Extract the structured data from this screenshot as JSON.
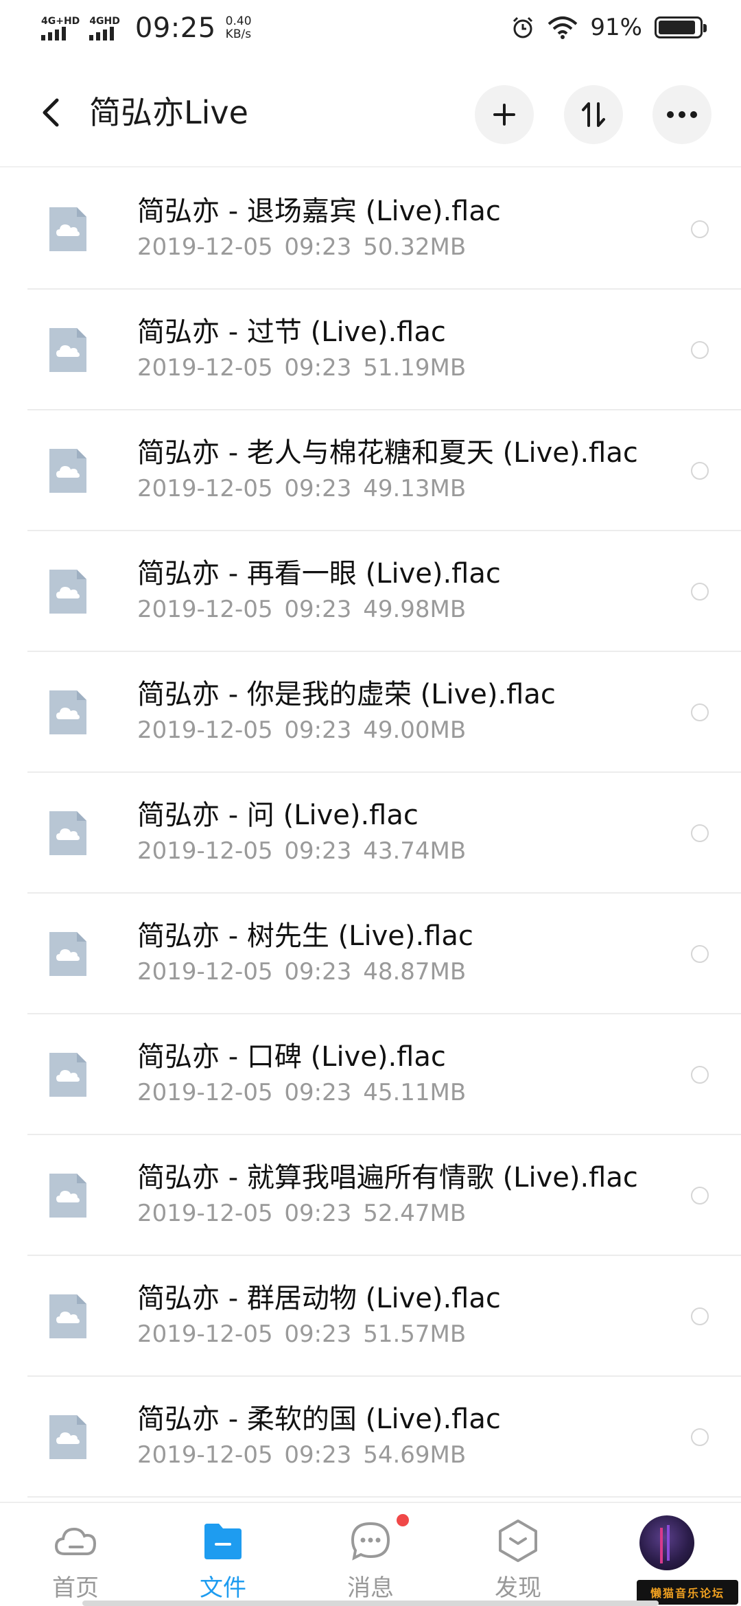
{
  "status_bar": {
    "signal1_label": "4G+HD",
    "signal2_label": "4GHD",
    "time": "09:25",
    "speed_value": "0.40",
    "speed_unit": "KB/s",
    "battery_text": "91%",
    "battery_level": 0.91
  },
  "header": {
    "title": "简弘亦Live",
    "back_icon": "chevron-left-icon",
    "add_icon": "plus-icon",
    "sort_icon": "sort-arrows-icon",
    "more_icon": "more-dots-icon"
  },
  "files": [
    {
      "name": "简弘亦 - 退场嘉宾 (Live).flac",
      "date": "2019-12-05",
      "time": "09:23",
      "size": "50.32MB"
    },
    {
      "name": "简弘亦 - 过节 (Live).flac",
      "date": "2019-12-05",
      "time": "09:23",
      "size": "51.19MB"
    },
    {
      "name": "简弘亦 - 老人与棉花糖和夏天 (Live).flac",
      "date": "2019-12-05",
      "time": "09:23",
      "size": "49.13MB"
    },
    {
      "name": "简弘亦 - 再看一眼 (Live).flac",
      "date": "2019-12-05",
      "time": "09:23",
      "size": "49.98MB"
    },
    {
      "name": "简弘亦 - 你是我的虚荣 (Live).flac",
      "date": "2019-12-05",
      "time": "09:23",
      "size": "49.00MB"
    },
    {
      "name": "简弘亦 - 问 (Live).flac",
      "date": "2019-12-05",
      "time": "09:23",
      "size": "43.74MB"
    },
    {
      "name": "简弘亦 - 树先生 (Live).flac",
      "date": "2019-12-05",
      "time": "09:23",
      "size": "48.87MB"
    },
    {
      "name": "简弘亦 - 口碑 (Live).flac",
      "date": "2019-12-05",
      "time": "09:23",
      "size": "45.11MB"
    },
    {
      "name": "简弘亦 - 就算我唱遍所有情歌 (Live).flac",
      "date": "2019-12-05",
      "time": "09:23",
      "size": "52.47MB"
    },
    {
      "name": "简弘亦 - 群居动物 (Live).flac",
      "date": "2019-12-05",
      "time": "09:23",
      "size": "51.57MB"
    },
    {
      "name": "简弘亦 - 柔软的国 (Live).flac",
      "date": "2019-12-05",
      "time": "09:23",
      "size": "54.69MB"
    }
  ],
  "bottom_nav": {
    "items": [
      {
        "label": "首页",
        "icon": "cloud-icon",
        "active": false
      },
      {
        "label": "文件",
        "icon": "folder-icon",
        "active": true
      },
      {
        "label": "消息",
        "icon": "message-icon",
        "active": false
      },
      {
        "label": "发现",
        "icon": "discover-icon",
        "active": false
      }
    ],
    "messages_badge": true
  },
  "watermark": "懒猫音乐论坛",
  "colors": {
    "accent": "#1e9cf0",
    "file_icon": "#b8c6d4",
    "meta_text": "#9a9a9a",
    "badge": "#f04848"
  }
}
